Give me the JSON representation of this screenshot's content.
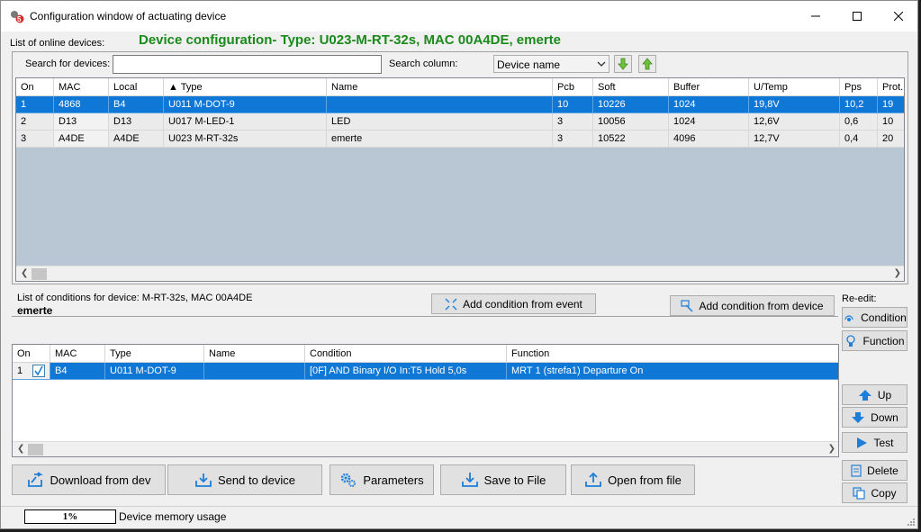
{
  "window": {
    "title": "Configuration window of actuating device",
    "config_title": "Device configuration- Type: U023-M-RT-32s, MAC 00A4DE, emerte"
  },
  "online": {
    "label": "List of online devices:",
    "search_label": "Search for devices:",
    "search_value": "",
    "search_column_label": "Search column:",
    "search_column_value": "Device name",
    "columns": [
      "On",
      "MAC",
      "Local",
      "▲ Type",
      "Name",
      "Pcb",
      "Soft",
      "Buffer",
      "U/Temp",
      "Pps",
      "Prot."
    ],
    "rows": [
      [
        "1",
        "4868",
        "B4",
        "U011 M-DOT-9",
        "",
        "10",
        "10226",
        "1024",
        "19,8V",
        "10,2",
        "19"
      ],
      [
        "2",
        "D13",
        "D13",
        "U017 M-LED-1",
        "LED",
        "3",
        "10056",
        "1024",
        "12,6V",
        "0,6",
        "10"
      ],
      [
        "3",
        "A4DE",
        "A4DE",
        "U023 M-RT-32s",
        "emerte",
        "3",
        "10522",
        "4096",
        "12,7V",
        "0,4",
        "20"
      ]
    ]
  },
  "conditions": {
    "label": "List of conditions for device: M-RT-32s, MAC 00A4DE",
    "device_name": "emerte",
    "add_from_event": "Add condition from event",
    "add_from_device": "Add condition from device",
    "columns": [
      "On",
      "MAC",
      "Type",
      "Name",
      "Condition",
      "Function"
    ],
    "rows": [
      [
        "1",
        "B4",
        "U011 M-DOT-9",
        "",
        "[0F] AND  Binary I/O In:T5   Hold 5,0s",
        "MRT 1 (strefa1) Departure On"
      ]
    ]
  },
  "side": {
    "reedit_label": "Re-edit:",
    "condition": "Condition",
    "function": "Function",
    "up": "Up",
    "down": "Down",
    "test": "Test",
    "delete": "Delete",
    "copy": "Copy"
  },
  "bottom": {
    "download": "Download from dev",
    "send": "Send to device",
    "parameters": "Parameters",
    "save": "Save to File",
    "open": "Open from file"
  },
  "status": {
    "memory_percent": "1%",
    "memory_label": "Device memory usage"
  },
  "colors": {
    "selection": "#0f78d7",
    "title_green": "#1a8a1a",
    "icon_blue": "#1e7fd8"
  }
}
